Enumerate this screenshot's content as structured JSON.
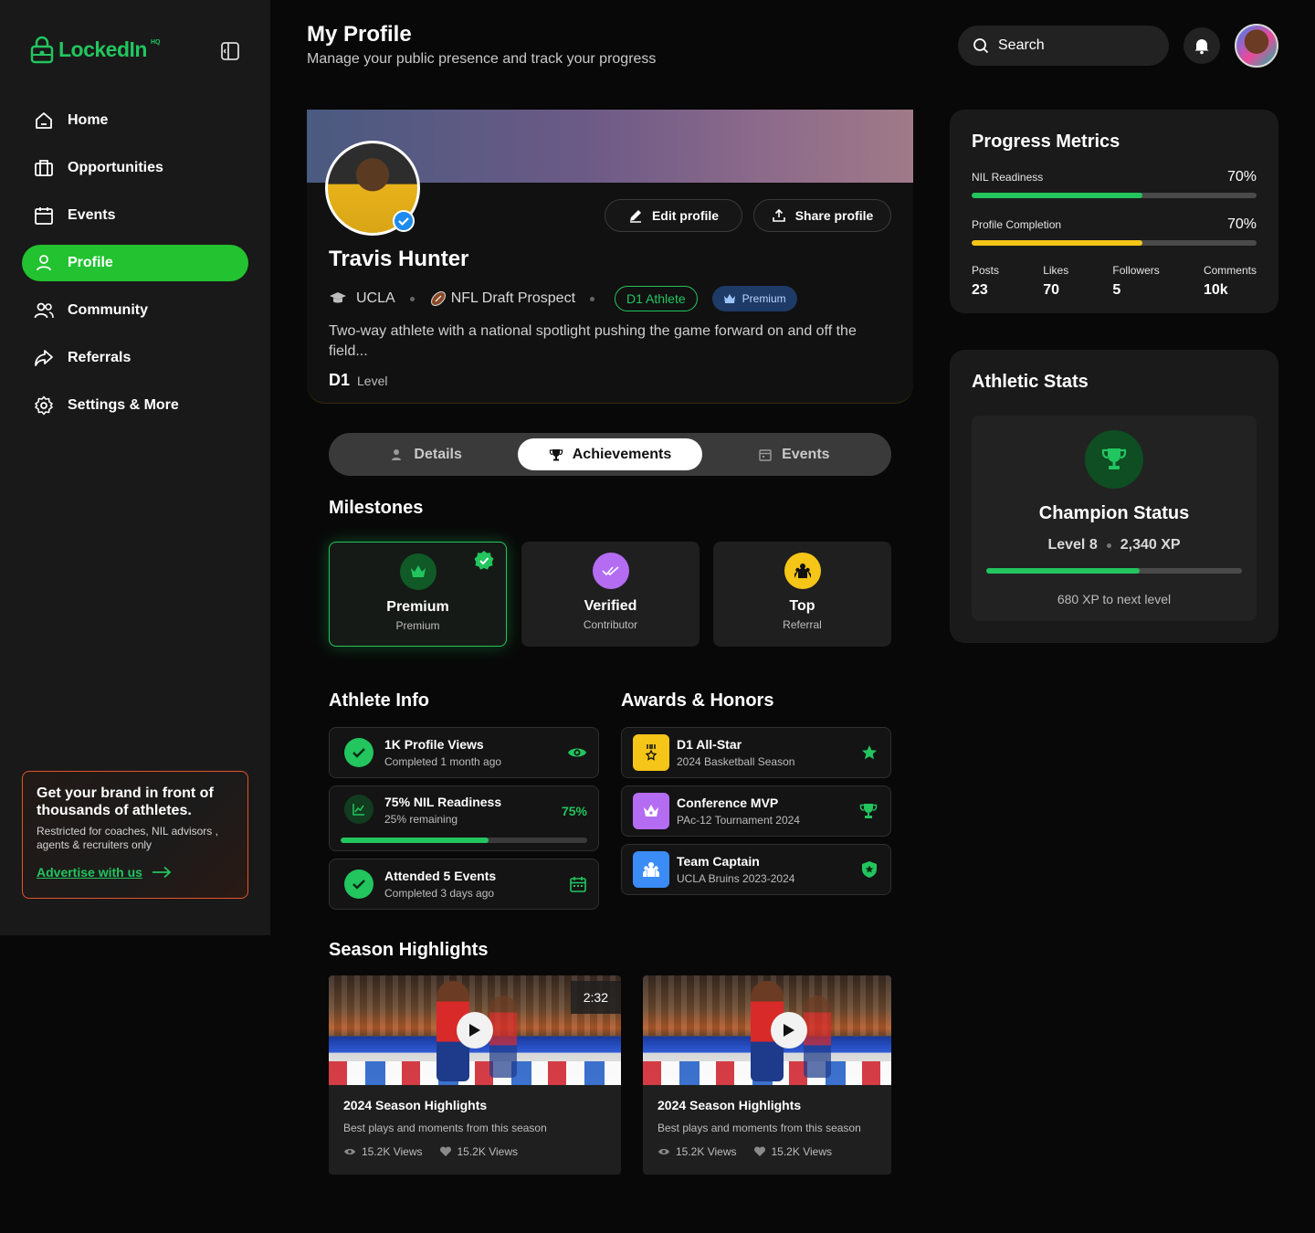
{
  "app": {
    "logo": "LockedIn",
    "logo_suffix": "HQ"
  },
  "sidebar": {
    "items": [
      {
        "label": "Home",
        "icon": "home-icon"
      },
      {
        "label": "Opportunities",
        "icon": "briefcase-icon"
      },
      {
        "label": "Events",
        "icon": "calendar-icon"
      },
      {
        "label": "Profile",
        "icon": "user-icon",
        "active": true
      },
      {
        "label": "Community",
        "icon": "users-icon"
      },
      {
        "label": "Referrals",
        "icon": "share-icon"
      },
      {
        "label": "Settings & More",
        "icon": "gear-icon"
      }
    ],
    "ad": {
      "title": "Get your brand in front of thousands of athletes.",
      "subtitle": "Restricted for coaches, NIL advisors , agents & recruiters only",
      "link": "Advertise with us"
    }
  },
  "header": {
    "title": "My Profile",
    "subtitle": "Manage your public presence and track your progress",
    "search_placeholder": "Search"
  },
  "profile": {
    "name": "Travis Hunter",
    "school": "UCLA",
    "role": "NFL Draft Prospect",
    "badge_level": "D1 Athlete",
    "badge_plan": "Premium",
    "bio": "Two-way athlete with a national spotlight pushing the game forward on and off the field...",
    "level_value": "D1",
    "level_label": "Level",
    "edit_label": "Edit profile",
    "share_label": "Share profile"
  },
  "tabs": [
    {
      "label": "Details",
      "active": false
    },
    {
      "label": "Achievements",
      "active": true
    },
    {
      "label": "Events",
      "active": false
    }
  ],
  "milestones": {
    "title": "Milestones",
    "items": [
      {
        "title": "Premium",
        "subtitle": "Premium",
        "icon": "crown-icon",
        "color": "#0f5a26",
        "active": true
      },
      {
        "title": "Verified",
        "subtitle": "Contributor",
        "icon": "double-check-icon",
        "color": "#b46cf2",
        "active": false
      },
      {
        "title": "Top",
        "subtitle": "Referral",
        "icon": "group-icon",
        "color": "#f5c518",
        "active": false
      }
    ]
  },
  "athlete_info": {
    "title": "Athlete Info",
    "items": [
      {
        "title": "1K Profile Views",
        "subtitle": "Completed 1 month ago",
        "trailing": "eye-icon"
      },
      {
        "title": "75% NIL Readiness",
        "subtitle": "25% remaining",
        "value": "75%",
        "progress": 0.6
      },
      {
        "title": "Attended 5 Events",
        "subtitle": "Completed 3 days ago",
        "trailing": "calendar-icon"
      }
    ]
  },
  "awards": {
    "title": "Awards & Honors",
    "items": [
      {
        "title": "D1 All-Star",
        "subtitle": "2024 Basketball Season",
        "icon": "medal-icon",
        "color": "#f5c518",
        "trailing": "star-icon"
      },
      {
        "title": "Conference MVP",
        "subtitle": "PAc-12 Tournament 2024",
        "icon": "crown-icon",
        "color": "#b46cf2",
        "trailing": "trophy-icon"
      },
      {
        "title": "Team Captain",
        "subtitle": "UCLA Bruins 2023-2024",
        "icon": "team-icon",
        "color": "#3b8cf6",
        "trailing": "shield-icon"
      }
    ]
  },
  "highlights": {
    "title": "Season Highlights",
    "videos": [
      {
        "title": "2024 Season Highlights",
        "description": "Best plays and moments from this season",
        "duration": "2:32",
        "views": "15.2K Views",
        "likes": "15.2K Views"
      },
      {
        "title": "2024 Season Highlights",
        "description": "Best plays and moments from this season",
        "views": "15.2K Views",
        "likes": "15.2K Views"
      }
    ]
  },
  "progress": {
    "title": "Progress Metrics",
    "metrics": [
      {
        "label": "NIL Readiness",
        "value": "70%",
        "fraction": 0.6,
        "color": "#22c55e"
      },
      {
        "label": "Profile Completion",
        "value": "70%",
        "fraction": 0.6,
        "color": "#f5c518"
      }
    ],
    "stats": [
      {
        "label": "Posts",
        "value": "23"
      },
      {
        "label": "Likes",
        "value": "70"
      },
      {
        "label": "Followers",
        "value": "5"
      },
      {
        "label": "Comments",
        "value": "10k"
      }
    ]
  },
  "athletic_stats": {
    "title": "Athletic Stats",
    "status": "Champion Status",
    "level": "Level 8",
    "xp": "2,340 XP",
    "progress": 0.6,
    "next": "680 XP to next level"
  },
  "colors": {
    "accent": "#22c55e",
    "ad_border": "#e5542a",
    "gold": "#f5c518",
    "purple": "#b46cf2",
    "blue": "#3b8cf6"
  }
}
